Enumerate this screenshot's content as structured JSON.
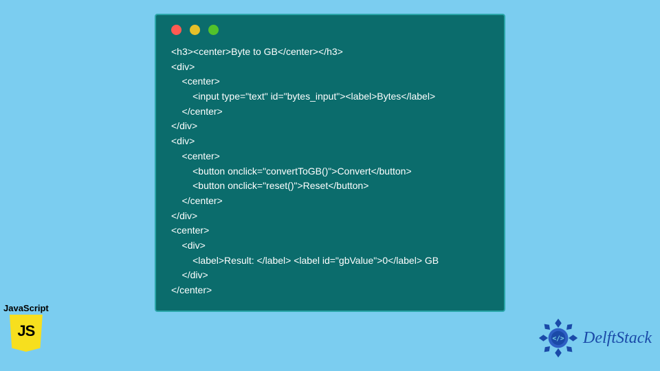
{
  "code_lines": [
    "<h3><center>Byte to GB</center></h3>",
    "<div>",
    "    <center>",
    "        <input type=\"text\" id=\"bytes_input\"><label>Bytes</label>",
    "    </center>",
    "</div>",
    "<div>",
    "    <center>",
    "        <button onclick=\"convertToGB()\">Convert</button>",
    "        <button onclick=\"reset()\">Reset</button>",
    "    </center>",
    "</div>",
    "<center>",
    "    <div>",
    "        <label>Result: </label> <label id=\"gbValue\">0</label> GB",
    "    </div>",
    "</center>"
  ],
  "js_badge": {
    "label": "JavaScript",
    "logo_text": "JS"
  },
  "brand": {
    "name": "DelftStack"
  },
  "colors": {
    "page_bg": "#7bcdf0",
    "panel_bg": "#0b6c6c",
    "panel_border": "#2aa6a9",
    "dot_red": "#ff5a52",
    "dot_yellow": "#e6c029",
    "dot_green": "#53c22b",
    "js_yellow": "#f7df1e",
    "brand_blue": "#1a4aa8"
  }
}
